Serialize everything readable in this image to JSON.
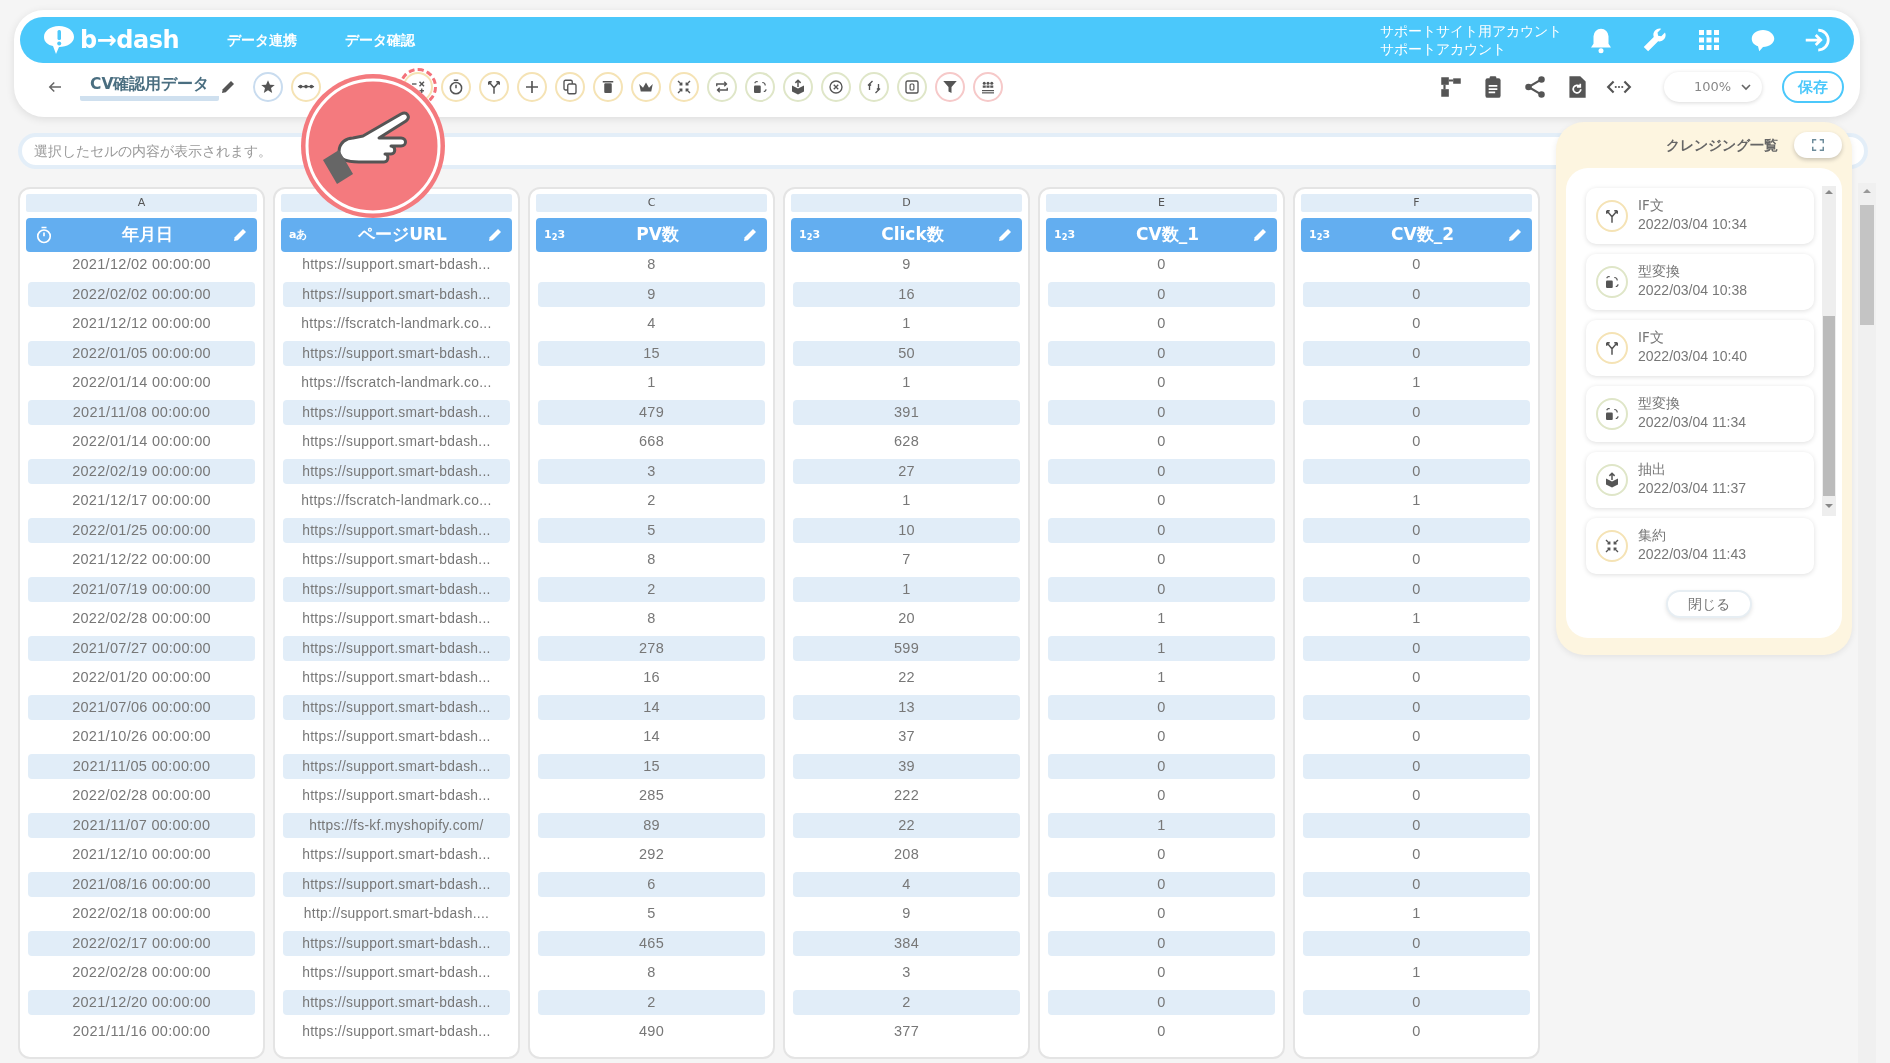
{
  "header": {
    "logo": "b→dash",
    "nav": [
      "データ連携",
      "データ確認"
    ],
    "account": [
      "サポートサイト用アカウント",
      "サポートアカウント"
    ]
  },
  "toolbar": {
    "title": "CV確認用データ",
    "tools": [
      {
        "kind": "star",
        "color": "#c9dcef",
        "highlighted": false
      },
      {
        "kind": "more",
        "color": "#f5e3b5",
        "highlighted": false
      },
      {
        "kind": "gap"
      },
      {
        "kind": "calc",
        "color": "#f5e3b5",
        "highlighted": true
      },
      {
        "kind": "timer",
        "color": "#f5e3b5",
        "highlighted": false
      },
      {
        "kind": "branch",
        "color": "#f5e3b5",
        "highlighted": false
      },
      {
        "kind": "plus",
        "color": "#f5e3b5",
        "highlighted": false
      },
      {
        "kind": "copy",
        "color": "#f5e3b5",
        "highlighted": false
      },
      {
        "kind": "trash",
        "color": "#f5e3b5",
        "highlighted": false
      },
      {
        "kind": "crown",
        "color": "#f5e3b5",
        "highlighted": false
      },
      {
        "kind": "compress",
        "color": "#f5e3b5",
        "highlighted": false
      },
      {
        "kind": "repeat",
        "color": "#dfe6c8",
        "highlighted": false
      },
      {
        "kind": "typeconv",
        "color": "#dfe6c8",
        "highlighted": false
      },
      {
        "kind": "extract",
        "color": "#dfe6c8",
        "highlighted": false
      },
      {
        "kind": "xcircle",
        "color": "#dfe6c8",
        "highlighted": false
      },
      {
        "kind": "translate",
        "color": "#dfe6c8",
        "highlighted": false
      },
      {
        "kind": "zero",
        "color": "#dfe6c8",
        "highlighted": false
      },
      {
        "kind": "filter",
        "color": "#f6c9c9",
        "highlighted": false
      },
      {
        "kind": "people",
        "color": "#f6c9c9",
        "highlighted": false
      }
    ],
    "zoom": "100%",
    "save": "保存"
  },
  "formula_bar": {
    "placeholder": "選択したセルの内容が表示されます。"
  },
  "table": {
    "columns": [
      {
        "letter": "A",
        "kind": "date",
        "name": "年月日"
      },
      {
        "kind": "text",
        "type_mark": "aあ",
        "name": "ページURL"
      },
      {
        "letter": "C",
        "kind": "number",
        "type_mark": "1$_{2}$3",
        "name": "PV数"
      },
      {
        "letter": "D",
        "kind": "number",
        "type_mark": "1$_{2}$3",
        "name": "Click数"
      },
      {
        "letter": "E",
        "kind": "number",
        "type_mark": "1$_{2}$3",
        "name": "CV数_1"
      },
      {
        "letter": "F",
        "kind": "number",
        "type_mark": "1$_{2}$3",
        "name": "CV数_2"
      }
    ],
    "rows": [
      [
        "2021/12/02 00:00:00",
        "https://support.smart-bdash...",
        "8",
        "9",
        "0",
        "0"
      ],
      [
        "2022/02/02 00:00:00",
        "https://support.smart-bdash...",
        "9",
        "16",
        "0",
        "0"
      ],
      [
        "2021/12/12 00:00:00",
        "https://fscratch-landmark.co...",
        "4",
        "1",
        "0",
        "0"
      ],
      [
        "2022/01/05 00:00:00",
        "https://support.smart-bdash...",
        "15",
        "50",
        "0",
        "0"
      ],
      [
        "2022/01/14 00:00:00",
        "https://fscratch-landmark.co...",
        "1",
        "1",
        "0",
        "1"
      ],
      [
        "2021/11/08 00:00:00",
        "https://support.smart-bdash...",
        "479",
        "391",
        "0",
        "0"
      ],
      [
        "2022/01/14 00:00:00",
        "https://support.smart-bdash...",
        "668",
        "628",
        "0",
        "0"
      ],
      [
        "2022/02/19 00:00:00",
        "https://support.smart-bdash...",
        "3",
        "27",
        "0",
        "0"
      ],
      [
        "2021/12/17 00:00:00",
        "https://fscratch-landmark.co...",
        "2",
        "1",
        "0",
        "1"
      ],
      [
        "2022/01/25 00:00:00",
        "https://support.smart-bdash...",
        "5",
        "10",
        "0",
        "0"
      ],
      [
        "2021/12/22 00:00:00",
        "https://support.smart-bdash...",
        "8",
        "7",
        "0",
        "0"
      ],
      [
        "2021/07/19 00:00:00",
        "https://support.smart-bdash...",
        "2",
        "1",
        "0",
        "0"
      ],
      [
        "2022/02/28 00:00:00",
        "https://support.smart-bdash...",
        "8",
        "20",
        "1",
        "1"
      ],
      [
        "2021/07/27 00:00:00",
        "https://support.smart-bdash...",
        "278",
        "599",
        "1",
        "0"
      ],
      [
        "2022/01/20 00:00:00",
        "https://support.smart-bdash...",
        "16",
        "22",
        "1",
        "0"
      ],
      [
        "2021/07/06 00:00:00",
        "https://support.smart-bdash...",
        "14",
        "13",
        "0",
        "0"
      ],
      [
        "2021/10/26 00:00:00",
        "https://support.smart-bdash...",
        "14",
        "37",
        "0",
        "0"
      ],
      [
        "2021/11/05 00:00:00",
        "https://support.smart-bdash...",
        "15",
        "39",
        "0",
        "0"
      ],
      [
        "2022/02/28 00:00:00",
        "https://support.smart-bdash...",
        "285",
        "222",
        "0",
        "0"
      ],
      [
        "2021/11/07 00:00:00",
        "https://fs-kf.myshopify.com/",
        "89",
        "22",
        "1",
        "0"
      ],
      [
        "2021/12/10 00:00:00",
        "https://support.smart-bdash...",
        "292",
        "208",
        "0",
        "0"
      ],
      [
        "2021/08/16 00:00:00",
        "https://support.smart-bdash...",
        "6",
        "4",
        "0",
        "0"
      ],
      [
        "2022/02/18 00:00:00",
        "http://support.smart-bdash....",
        "5",
        "9",
        "0",
        "1"
      ],
      [
        "2022/02/17 00:00:00",
        "https://support.smart-bdash...",
        "465",
        "384",
        "0",
        "0"
      ],
      [
        "2022/02/28 00:00:00",
        "https://support.smart-bdash...",
        "8",
        "3",
        "0",
        "1"
      ],
      [
        "2021/12/20 00:00:00",
        "https://support.smart-bdash...",
        "2",
        "2",
        "0",
        "0"
      ],
      [
        "2021/11/16 00:00:00",
        "https://support.smart-bdash...",
        "490",
        "377",
        "0",
        "0"
      ]
    ]
  },
  "cleansing_panel": {
    "title": "クレンジング一覧",
    "items": [
      {
        "kind": "if",
        "name": "IF文",
        "time": "2022/03/04 10:34"
      },
      {
        "kind": "typeconv",
        "name": "型変換",
        "time": "2022/03/04 10:38"
      },
      {
        "kind": "if",
        "name": "IF文",
        "time": "2022/03/04 10:40"
      },
      {
        "kind": "typeconv",
        "name": "型変換",
        "time": "2022/03/04 11:34"
      },
      {
        "kind": "extract",
        "name": "抽出",
        "time": "2022/03/04 11:37"
      },
      {
        "kind": "aggregate",
        "name": "集約",
        "time": "2022/03/04 11:43"
      }
    ],
    "close": "閉じる"
  }
}
